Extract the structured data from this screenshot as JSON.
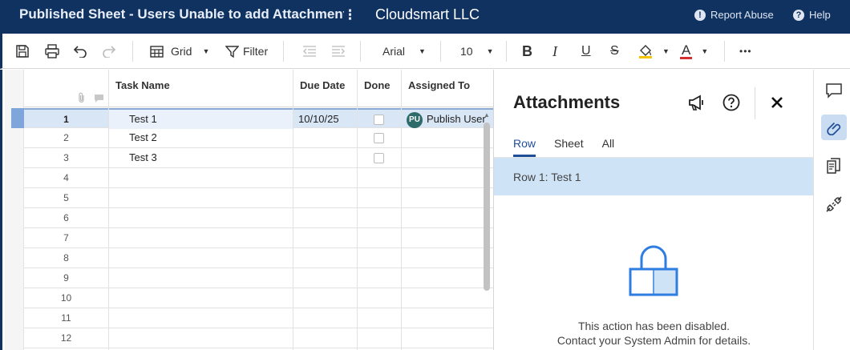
{
  "titlebar": {
    "doc_title": "Published Sheet - Users Unable to add Attachments",
    "menu": "⋮",
    "org_name": "Cloudsmart LLC",
    "report_abuse": "Report Abuse",
    "help": "Help",
    "background_color": "#0f3260"
  },
  "toolbar": {
    "view_label": "Grid",
    "filter_label": "Filter",
    "font_family": "Arial",
    "font_size": "10",
    "more": "•••",
    "icons": [
      "save-icon",
      "print-icon",
      "undo-icon",
      "redo-icon",
      "grid-icon",
      "filter-icon",
      "outdent-icon",
      "indent-icon",
      "bold-icon",
      "italic-icon",
      "underline-icon",
      "strikethrough-icon",
      "fill-color-icon",
      "text-color-icon",
      "more-icon"
    ],
    "bold_glyph": "B",
    "italic_glyph": "I",
    "underline_glyph": "U",
    "strike_glyph": "S",
    "text_color_glyph": "A",
    "text_color_swatch": "#d32f2f",
    "fill_color_swatch": "#f5c400"
  },
  "grid": {
    "columns": [
      "Task Name",
      "Due Date",
      "Done",
      "Assigned To"
    ],
    "rows": [
      {
        "num": "1",
        "task": "Test 1",
        "due": "10/10/25",
        "assigned_initials": "PU",
        "assigned": "Publish User"
      },
      {
        "num": "2",
        "task": "Test 2",
        "due": "",
        "assigned_initials": "",
        "assigned": ""
      },
      {
        "num": "3",
        "task": "Test 3",
        "due": "",
        "assigned_initials": "",
        "assigned": ""
      },
      {
        "num": "4",
        "task": "",
        "due": "",
        "assigned_initials": "",
        "assigned": ""
      },
      {
        "num": "5",
        "task": "",
        "due": "",
        "assigned_initials": "",
        "assigned": ""
      },
      {
        "num": "6",
        "task": "",
        "due": "",
        "assigned_initials": "",
        "assigned": ""
      },
      {
        "num": "7",
        "task": "",
        "due": "",
        "assigned_initials": "",
        "assigned": ""
      },
      {
        "num": "8",
        "task": "",
        "due": "",
        "assigned_initials": "",
        "assigned": ""
      },
      {
        "num": "9",
        "task": "",
        "due": "",
        "assigned_initials": "",
        "assigned": ""
      },
      {
        "num": "10",
        "task": "",
        "due": "",
        "assigned_initials": "",
        "assigned": ""
      },
      {
        "num": "11",
        "task": "",
        "due": "",
        "assigned_initials": "",
        "assigned": ""
      },
      {
        "num": "12",
        "task": "",
        "due": "",
        "assigned_initials": "",
        "assigned": ""
      }
    ],
    "selected_row": "1",
    "selected_color": "#d9e6f6"
  },
  "panel": {
    "title": "Attachments",
    "tabs": [
      "Row",
      "Sheet",
      "All"
    ],
    "active_tab": "Row",
    "row_label": "Row 1: Test 1",
    "disabled_line1": "This action has been disabled.",
    "disabled_line2": "Contact your System Admin for details.",
    "accent_color": "#1f4e99",
    "band_color": "#cfe3f7",
    "icons": [
      "announce-icon",
      "help-icon",
      "close-icon",
      "lock-icon"
    ]
  },
  "rail": {
    "icons": [
      "conversations-icon",
      "attachments-icon",
      "proofing-icon",
      "connections-icon"
    ],
    "active": "attachments-icon"
  }
}
